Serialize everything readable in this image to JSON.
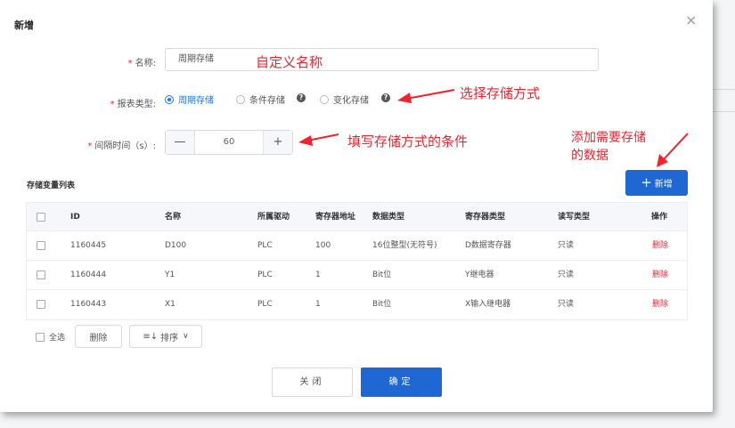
{
  "dialog": {
    "title": "新增",
    "close_glyph": "×"
  },
  "form": {
    "name_label": "名称:",
    "name_value": "周期存储",
    "report_type_label": "报表类型:",
    "report_types": [
      {
        "label": "周期存储",
        "checked": true
      },
      {
        "label": "条件存储",
        "checked": false
      },
      {
        "label": "变化存储",
        "checked": false
      }
    ],
    "help_glyph": "?",
    "interval_label": "间隔时间（s）:",
    "interval_value": "60",
    "minus_glyph": "—",
    "plus_glyph": "+",
    "required_mark": "*"
  },
  "annotations": {
    "custom_name": "自定义名称",
    "choose_storage": "选择存储方式",
    "fill_condition": "填写存储方式的条件",
    "add_data_line1": "添加需要存储",
    "add_data_line2": "的数据",
    "color": "#f5222d"
  },
  "variables": {
    "section_title": "存储变量列表",
    "add_button_label": "新增",
    "add_icon": "+",
    "columns": [
      "ID",
      "名称",
      "所属驱动",
      "寄存器地址",
      "数据类型",
      "寄存器类型",
      "读写类型",
      "操作"
    ],
    "rows": [
      {
        "id": "1160445",
        "name": "D100",
        "driver": "PLC",
        "address": "100",
        "data_type": "16位整型(无符号)",
        "register_type": "D数据寄存器",
        "rw": "只读",
        "action": "删除"
      },
      {
        "id": "1160444",
        "name": "Y1",
        "driver": "PLC",
        "address": "1",
        "data_type": "Bit位",
        "register_type": "Y继电器",
        "rw": "只读",
        "action": "删除"
      },
      {
        "id": "1160443",
        "name": "X1",
        "driver": "PLC",
        "address": "1",
        "data_type": "Bit位",
        "register_type": "X输入继电器",
        "rw": "只读",
        "action": "删除"
      }
    ]
  },
  "footer": {
    "select_all": "全选",
    "delete_label": "删除",
    "sort_icon": "≡↓",
    "sort_label": "排序",
    "sort_chevron": "∨",
    "close_label": "关闭",
    "ok_label": "确定"
  },
  "colors": {
    "primary": "#1f67d2",
    "danger": "#f5222d"
  }
}
